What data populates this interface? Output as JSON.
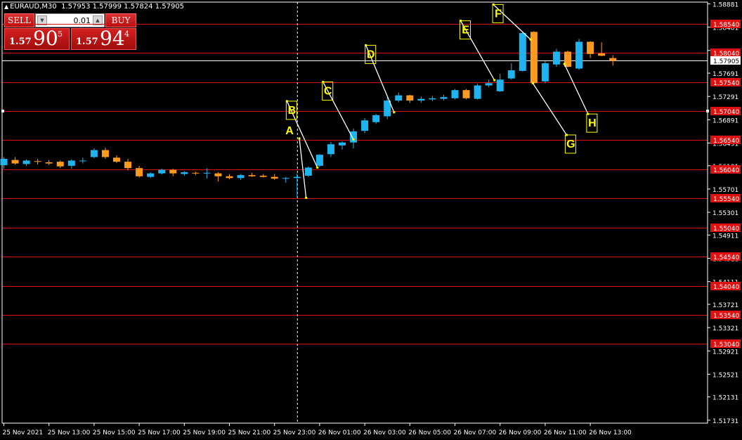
{
  "header": {
    "symbol": "EURAUD,M30",
    "ohlc": "1.57953 1.57999 1.57824 1.57905"
  },
  "trade_panel": {
    "sell_label": "SELL",
    "buy_label": "BUY",
    "lot_size": "0.01",
    "sell_prefix": "1.57",
    "sell_big": "90",
    "sell_sup": "5",
    "buy_prefix": "1.57",
    "buy_big": "94",
    "buy_sup": "4"
  },
  "chart_data": {
    "type": "candlestick",
    "symbol": "EURAUD",
    "timeframe": "M30",
    "ylim": [
      1.51681,
      1.58911
    ],
    "price_ticks": [
      "1.58881",
      "1.58481",
      "1.58081",
      "1.57691",
      "1.57291",
      "1.56891",
      "1.56491",
      "1.56101",
      "1.55701",
      "1.55301",
      "1.54911",
      "1.54511",
      "1.54111",
      "1.53721",
      "1.53321",
      "1.52921",
      "1.52521",
      "1.52131",
      "1.51731"
    ],
    "time_labels": [
      "25 Nov 2021",
      "25 Nov 13:00",
      "25 Nov 15:00",
      "25 Nov 17:00",
      "25 Nov 19:00",
      "25 Nov 21:00",
      "25 Nov 23:00",
      "26 Nov 01:00",
      "26 Nov 03:00",
      "26 Nov 05:00",
      "26 Nov 07:00",
      "26 Nov 09:00",
      "26 Nov 11:00",
      "26 Nov 13:00"
    ],
    "levels": [
      "1.58540",
      "1.58040",
      "1.57540",
      "1.57040",
      "1.56540",
      "1.56040",
      "1.55540",
      "1.55040",
      "1.54540",
      "1.54040",
      "1.53540",
      "1.53040"
    ],
    "current_price": "1.57905",
    "up_color": "#1eb4f0",
    "down_color": "#ff9a1e",
    "level_color": "#e01010",
    "current_color": "#ffffff",
    "candles": [
      [
        1.5611,
        1.5625,
        1.5605,
        1.5622
      ],
      [
        1.562,
        1.5625,
        1.5612,
        1.5614
      ],
      [
        1.5613,
        1.5621,
        1.561,
        1.5619
      ],
      [
        1.5618,
        1.5622,
        1.5612,
        1.5617
      ],
      [
        1.5616,
        1.562,
        1.5611,
        1.5614
      ],
      [
        1.5617,
        1.5619,
        1.5606,
        1.5609
      ],
      [
        1.561,
        1.5621,
        1.5605,
        1.5619
      ],
      [
        1.5618,
        1.5624,
        1.5614,
        1.5619
      ],
      [
        1.5625,
        1.564,
        1.5623,
        1.5637
      ],
      [
        1.5637,
        1.5641,
        1.5622,
        1.5625
      ],
      [
        1.5624,
        1.5628,
        1.5615,
        1.5617
      ],
      [
        1.5617,
        1.5622,
        1.5602,
        1.5606
      ],
      [
        1.5606,
        1.561,
        1.559,
        1.5592
      ],
      [
        1.5591,
        1.5599,
        1.5589,
        1.5597
      ],
      [
        1.5597,
        1.5605,
        1.5595,
        1.5603
      ],
      [
        1.5603,
        1.5605,
        1.5592,
        1.5597
      ],
      [
        1.5596,
        1.5601,
        1.5593,
        1.5599
      ],
      [
        1.5598,
        1.56,
        1.5594,
        1.5597
      ],
      [
        1.5597,
        1.5606,
        1.5588,
        1.5598
      ],
      [
        1.5597,
        1.5599,
        1.5583,
        1.5592
      ],
      [
        1.5592,
        1.5596,
        1.5587,
        1.5589
      ],
      [
        1.5589,
        1.5596,
        1.5586,
        1.5594
      ],
      [
        1.5594,
        1.5598,
        1.5591,
        1.5592
      ],
      [
        1.5593,
        1.5596,
        1.559,
        1.5591
      ],
      [
        1.5591,
        1.5596,
        1.5586,
        1.5588
      ],
      [
        1.5588,
        1.5591,
        1.5581,
        1.5589
      ],
      [
        1.5589,
        1.5597,
        1.5555,
        1.5591
      ],
      [
        1.5593,
        1.5609,
        1.5591,
        1.5607
      ],
      [
        1.561,
        1.563,
        1.5608,
        1.5629
      ],
      [
        1.563,
        1.5651,
        1.5625,
        1.5647
      ],
      [
        1.5645,
        1.5652,
        1.5638,
        1.565
      ],
      [
        1.565,
        1.5674,
        1.564,
        1.5669
      ],
      [
        1.567,
        1.5692,
        1.5666,
        1.5688
      ],
      [
        1.5685,
        1.5699,
        1.5682,
        1.5697
      ],
      [
        1.5695,
        1.5728,
        1.569,
        1.5722
      ],
      [
        1.5722,
        1.5736,
        1.5719,
        1.5731
      ],
      [
        1.5731,
        1.5732,
        1.5718,
        1.5722
      ],
      [
        1.5722,
        1.5729,
        1.5718,
        1.5725
      ],
      [
        1.5724,
        1.573,
        1.5721,
        1.5726
      ],
      [
        1.5725,
        1.5732,
        1.5722,
        1.5728
      ],
      [
        1.5726,
        1.5742,
        1.5724,
        1.574
      ],
      [
        1.574,
        1.5742,
        1.5724,
        1.5726
      ],
      [
        1.5725,
        1.5751,
        1.5724,
        1.5748
      ],
      [
        1.5748,
        1.5758,
        1.5745,
        1.5752
      ],
      [
        1.5738,
        1.5768,
        1.5737,
        1.5758
      ],
      [
        1.576,
        1.5786,
        1.5758,
        1.5774
      ],
      [
        1.5773,
        1.5841,
        1.5772,
        1.5838
      ],
      [
        1.584,
        1.5841,
        1.5751,
        1.5752
      ],
      [
        1.5755,
        1.579,
        1.5752,
        1.5786
      ],
      [
        1.5784,
        1.5811,
        1.578,
        1.5806
      ],
      [
        1.5806,
        1.5808,
        1.5779,
        1.578
      ],
      [
        1.5777,
        1.5828,
        1.5775,
        1.5823
      ],
      [
        1.5823,
        1.5824,
        1.5795,
        1.5802
      ],
      [
        1.5803,
        1.5822,
        1.5798,
        1.5799
      ],
      [
        1.5795,
        1.58,
        1.5782,
        1.579
      ]
    ],
    "annotations": [
      {
        "label": "A",
        "from": [
          26.2,
          1.5657
        ],
        "to": [
          26.8,
          1.5555
        ]
      },
      {
        "label": "B",
        "from": [
          25.1,
          1.5721
        ],
        "to": [
          27.8,
          1.5607
        ]
      },
      {
        "label": "C",
        "from": [
          28.3,
          1.5754
        ],
        "to": [
          31.0,
          1.5655
        ]
      },
      {
        "label": "D",
        "from": [
          32.1,
          1.5817
        ],
        "to": [
          34.6,
          1.5702
        ]
      },
      {
        "label": "E",
        "from": [
          40.5,
          1.5859
        ],
        "to": [
          43.5,
          1.5757
        ]
      },
      {
        "label": "F",
        "from": [
          43.4,
          1.5887
        ],
        "to": [
          46.7,
          1.5827
        ]
      },
      {
        "label": "G",
        "from": [
          46.9,
          1.5752
        ],
        "to": [
          49.9,
          1.5663
        ]
      },
      {
        "label": "H",
        "from": [
          49.7,
          1.5785
        ],
        "to": [
          51.8,
          1.5699
        ]
      }
    ]
  }
}
